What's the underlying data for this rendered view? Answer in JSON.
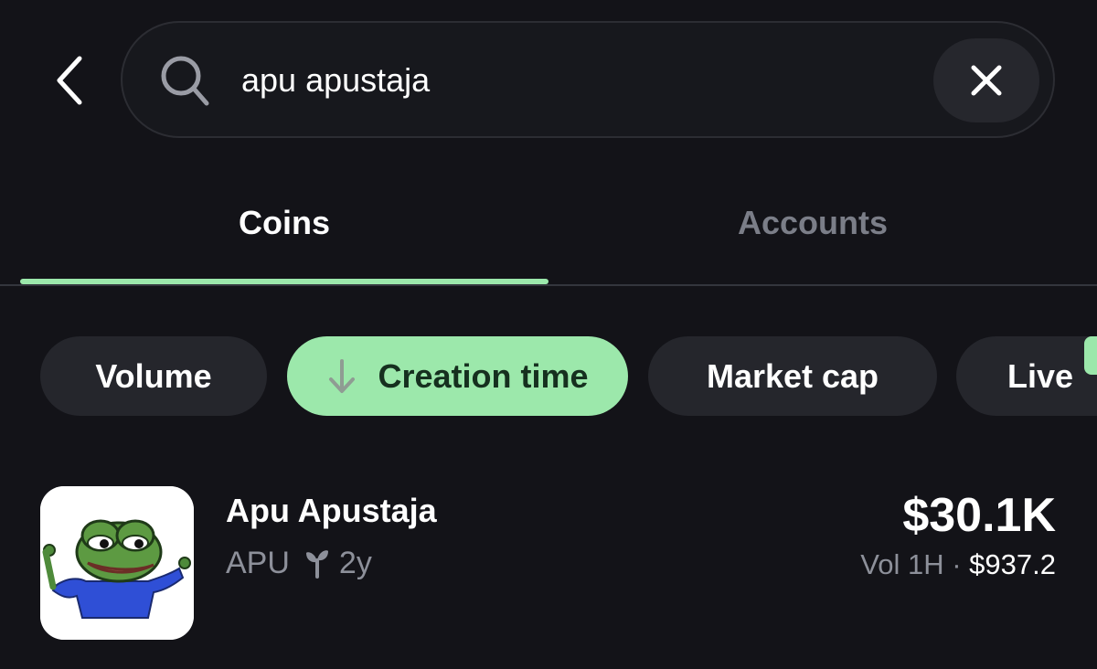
{
  "search": {
    "query": "apu apustaja",
    "back_icon": "chevron-left-icon",
    "search_icon": "search-icon",
    "clear_icon": "close-icon"
  },
  "tabs": [
    {
      "label": "Coins",
      "active": true
    },
    {
      "label": "Accounts",
      "active": false
    }
  ],
  "filters": [
    {
      "label": "Volume",
      "active": false
    },
    {
      "label": "Creation time",
      "active": true,
      "icon": "arrow-down-icon"
    },
    {
      "label": "Market cap",
      "active": false
    },
    {
      "label": "Live",
      "active": false
    }
  ],
  "results": [
    {
      "name": "Apu Apustaja",
      "ticker": "APU",
      "age_icon": "sprout-icon",
      "age": "2y",
      "price": "$30.1K",
      "volume_label": "Vol 1H · ",
      "volume_value": "$937.2"
    }
  ],
  "colors": {
    "background": "#131318",
    "accent": "#9ce8ab",
    "chip": "#25262c",
    "muted_text": "#8d909a"
  }
}
